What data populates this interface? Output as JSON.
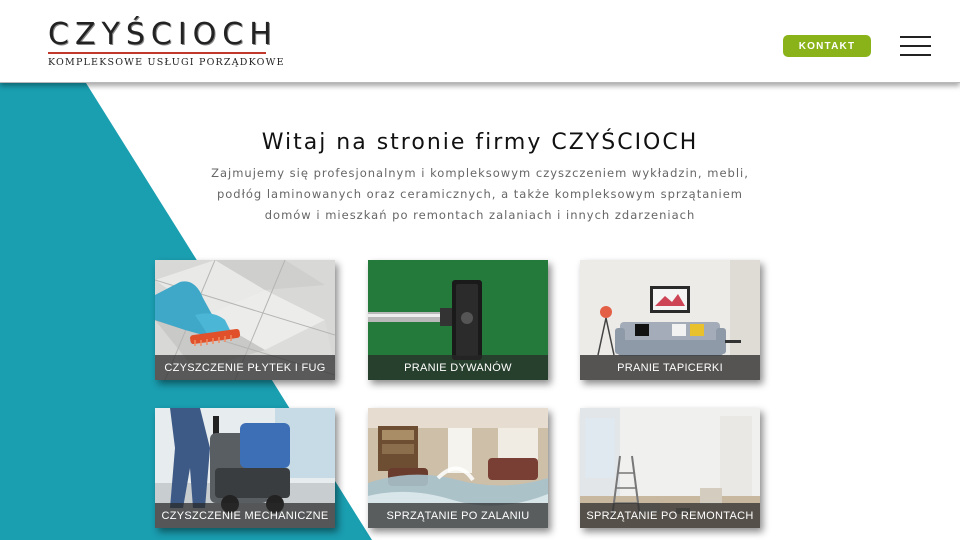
{
  "colors": {
    "teal": "#1a9fb1",
    "accent_green": "#8ab31a",
    "logo_red": "#c0392b"
  },
  "header": {
    "logo_title": "CZYŚCIOCH",
    "logo_subtitle": "KOMPLEKSOWE USŁUGI PORZĄDKOWE",
    "contact_button": "KONTAKT",
    "menu_icon": "hamburger-menu-icon"
  },
  "intro": {
    "title": "Witaj na stronie firmy CZYŚCIOCH",
    "line1": "Zajmujemy się profesjonalnym i kompleksowym czyszczeniem wykładzin, mebli,",
    "line2": "podłóg laminowanych oraz ceramicznych, a także kompleksowym sprzątaniem",
    "line3": "domów i mieszkań po remontach zalaniach i innych zdarzeniach"
  },
  "services": [
    {
      "label": "CZYSZCZENIE PŁYTEK I FUG"
    },
    {
      "label": "PRANIE DYWANÓW"
    },
    {
      "label": "PRANIE TAPICERKI"
    },
    {
      "label": "CZYSZCZENIE MECHANICZNE"
    },
    {
      "label": "SPRZĄTANIE PO ZALANIU"
    },
    {
      "label": "SPRZĄTANIE PO REMONTACH"
    }
  ]
}
